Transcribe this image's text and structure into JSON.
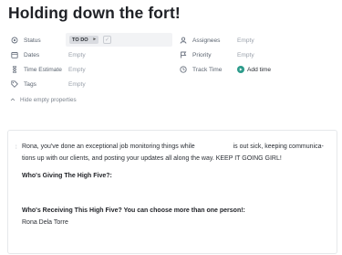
{
  "task": {
    "title": "Holding down the fort!"
  },
  "properties": {
    "status": {
      "label": "Status",
      "value": "TO DO",
      "arrow": "▸",
      "check": "✓"
    },
    "dates": {
      "label": "Dates",
      "value": "Empty"
    },
    "time_estimate": {
      "label": "Time Estimate",
      "value": "Empty"
    },
    "tags": {
      "label": "Tags",
      "value": "Empty"
    },
    "assignees": {
      "label": "Assignees",
      "value": "Empty"
    },
    "priority": {
      "label": "Priority",
      "value": "Empty"
    },
    "track_time": {
      "label": "Track Time",
      "action": "Add time"
    },
    "hide_empty": "Hide empty properties"
  },
  "description": {
    "paragraph_part1": "Rona, you've done an exceptional job monitoring things while",
    "paragraph_part2": "is out sick, keeping communica-",
    "paragraph_line2": "tions up with our clients, and posting your updates all along the way. KEEP IT GOING GIRL!",
    "giver_heading": "Who's Giving The High Five?:",
    "receiver_heading": "Who's Receiving This High Five? You can choose more than one person!:",
    "receiver_name": "Rona Dela Torre"
  },
  "colors": {
    "accent": "#2c9b8b",
    "muted": "#9aa1ab",
    "text": "#2a2e34"
  },
  "icons": {
    "status": "status-icon",
    "dates": "calendar-icon",
    "time_estimate": "hourglass-icon",
    "tags": "tag-icon",
    "assignees": "user-icon",
    "priority": "flag-icon",
    "track_time": "clock-icon",
    "hide": "chevron-up-icon"
  }
}
